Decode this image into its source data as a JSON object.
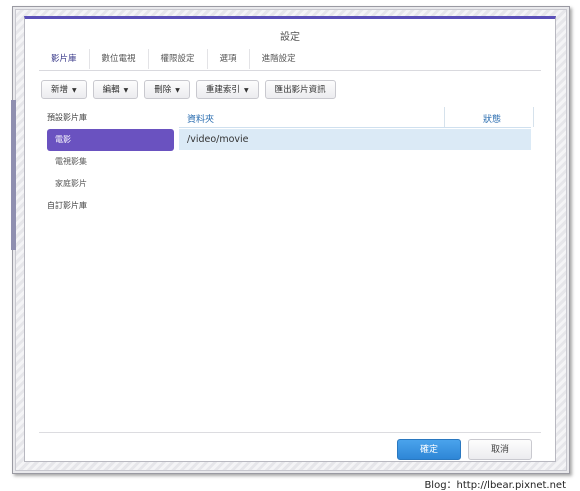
{
  "dialog": {
    "title": "設定"
  },
  "tabs": [
    {
      "label": "影片庫",
      "active": true
    },
    {
      "label": "數位電視",
      "active": false
    },
    {
      "label": "權限設定",
      "active": false
    },
    {
      "label": "選項",
      "active": false
    },
    {
      "label": "進階設定",
      "active": false
    }
  ],
  "toolbar": {
    "add_label": "新增",
    "edit_label": "編輯",
    "delete_label": "刪除",
    "reindex_label": "重建索引",
    "export_label": "匯出影片資訊"
  },
  "sidebar": {
    "default_group": "預設影片庫",
    "items": [
      {
        "label": "電影",
        "selected": true
      },
      {
        "label": "電視影集",
        "selected": false
      },
      {
        "label": "家庭影片",
        "selected": false
      }
    ],
    "custom_group": "自訂影片庫"
  },
  "grid": {
    "columns": {
      "folder": "資料夾",
      "status": "狀態"
    },
    "rows": [
      {
        "folder": "/video/movie",
        "status": ""
      }
    ]
  },
  "footer": {
    "ok_label": "確定",
    "cancel_label": "取消"
  },
  "credit": "Blog：http://lbear.pixnet.net",
  "colors": {
    "accent": "#6a52c0",
    "primary_button": "#2e86d6",
    "header_text": "#2a6db0"
  }
}
